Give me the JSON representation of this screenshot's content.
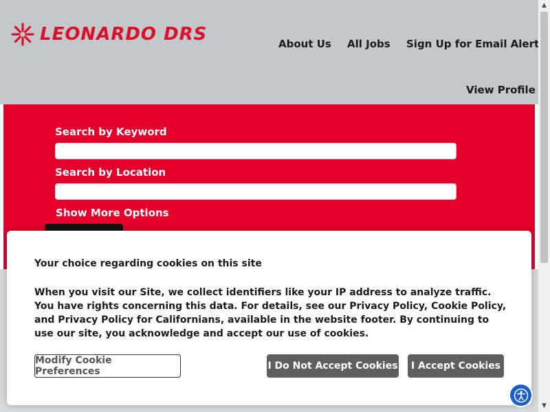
{
  "header": {
    "logo_text": "LEONARDO DRS",
    "nav": {
      "about": "About Us",
      "all_jobs": "All Jobs",
      "email_alerts": "Sign Up for Email Alerts",
      "view_profile": "View Profile"
    }
  },
  "search": {
    "keyword_label": "Search by Keyword",
    "keyword_value": "",
    "location_label": "Search by Location",
    "location_value": "",
    "more_options": "Show More Options"
  },
  "cookie_banner": {
    "title": "Your choice regarding cookies on this site",
    "body": "When you visit our Site, we collect identifiers like your IP address to analyze traffic. You have rights concerning this data. For details, see our Privacy Policy, Cookie Policy, and Privacy Policy for Californians, available in the website footer. By continuing to use our site, you acknowledge and accept our use of cookies.",
    "modify_label": "Modify Cookie Preferences",
    "decline_label": "I Do Not Accept Cookies",
    "accept_label": "I Accept Cookies"
  },
  "icons": {
    "logo": "leonardo-burst-icon",
    "accessibility": "accessibility-icon"
  },
  "colors": {
    "brand_red": "#e4002b",
    "logo_red": "#d8102c",
    "header_gray": "#c3c7ca",
    "button_gray": "#5f5f5f",
    "accessibility_blue": "#1a5fc8"
  }
}
